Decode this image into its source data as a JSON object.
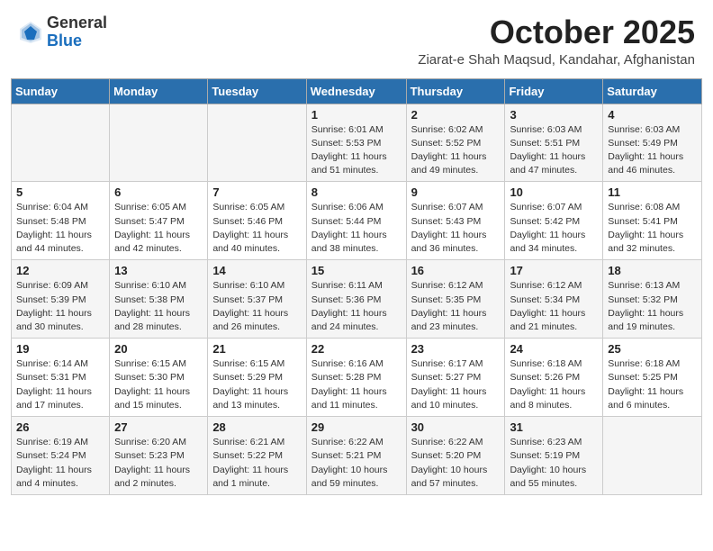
{
  "header": {
    "logo_general": "General",
    "logo_blue": "Blue",
    "month_title": "October 2025",
    "location": "Ziarat-e Shah Maqsud, Kandahar, Afghanistan"
  },
  "days_of_week": [
    "Sunday",
    "Monday",
    "Tuesday",
    "Wednesday",
    "Thursday",
    "Friday",
    "Saturday"
  ],
  "weeks": [
    [
      {
        "num": "",
        "info": ""
      },
      {
        "num": "",
        "info": ""
      },
      {
        "num": "",
        "info": ""
      },
      {
        "num": "1",
        "info": "Sunrise: 6:01 AM\nSunset: 5:53 PM\nDaylight: 11 hours\nand 51 minutes."
      },
      {
        "num": "2",
        "info": "Sunrise: 6:02 AM\nSunset: 5:52 PM\nDaylight: 11 hours\nand 49 minutes."
      },
      {
        "num": "3",
        "info": "Sunrise: 6:03 AM\nSunset: 5:51 PM\nDaylight: 11 hours\nand 47 minutes."
      },
      {
        "num": "4",
        "info": "Sunrise: 6:03 AM\nSunset: 5:49 PM\nDaylight: 11 hours\nand 46 minutes."
      }
    ],
    [
      {
        "num": "5",
        "info": "Sunrise: 6:04 AM\nSunset: 5:48 PM\nDaylight: 11 hours\nand 44 minutes."
      },
      {
        "num": "6",
        "info": "Sunrise: 6:05 AM\nSunset: 5:47 PM\nDaylight: 11 hours\nand 42 minutes."
      },
      {
        "num": "7",
        "info": "Sunrise: 6:05 AM\nSunset: 5:46 PM\nDaylight: 11 hours\nand 40 minutes."
      },
      {
        "num": "8",
        "info": "Sunrise: 6:06 AM\nSunset: 5:44 PM\nDaylight: 11 hours\nand 38 minutes."
      },
      {
        "num": "9",
        "info": "Sunrise: 6:07 AM\nSunset: 5:43 PM\nDaylight: 11 hours\nand 36 minutes."
      },
      {
        "num": "10",
        "info": "Sunrise: 6:07 AM\nSunset: 5:42 PM\nDaylight: 11 hours\nand 34 minutes."
      },
      {
        "num": "11",
        "info": "Sunrise: 6:08 AM\nSunset: 5:41 PM\nDaylight: 11 hours\nand 32 minutes."
      }
    ],
    [
      {
        "num": "12",
        "info": "Sunrise: 6:09 AM\nSunset: 5:39 PM\nDaylight: 11 hours\nand 30 minutes."
      },
      {
        "num": "13",
        "info": "Sunrise: 6:10 AM\nSunset: 5:38 PM\nDaylight: 11 hours\nand 28 minutes."
      },
      {
        "num": "14",
        "info": "Sunrise: 6:10 AM\nSunset: 5:37 PM\nDaylight: 11 hours\nand 26 minutes."
      },
      {
        "num": "15",
        "info": "Sunrise: 6:11 AM\nSunset: 5:36 PM\nDaylight: 11 hours\nand 24 minutes."
      },
      {
        "num": "16",
        "info": "Sunrise: 6:12 AM\nSunset: 5:35 PM\nDaylight: 11 hours\nand 23 minutes."
      },
      {
        "num": "17",
        "info": "Sunrise: 6:12 AM\nSunset: 5:34 PM\nDaylight: 11 hours\nand 21 minutes."
      },
      {
        "num": "18",
        "info": "Sunrise: 6:13 AM\nSunset: 5:32 PM\nDaylight: 11 hours\nand 19 minutes."
      }
    ],
    [
      {
        "num": "19",
        "info": "Sunrise: 6:14 AM\nSunset: 5:31 PM\nDaylight: 11 hours\nand 17 minutes."
      },
      {
        "num": "20",
        "info": "Sunrise: 6:15 AM\nSunset: 5:30 PM\nDaylight: 11 hours\nand 15 minutes."
      },
      {
        "num": "21",
        "info": "Sunrise: 6:15 AM\nSunset: 5:29 PM\nDaylight: 11 hours\nand 13 minutes."
      },
      {
        "num": "22",
        "info": "Sunrise: 6:16 AM\nSunset: 5:28 PM\nDaylight: 11 hours\nand 11 minutes."
      },
      {
        "num": "23",
        "info": "Sunrise: 6:17 AM\nSunset: 5:27 PM\nDaylight: 11 hours\nand 10 minutes."
      },
      {
        "num": "24",
        "info": "Sunrise: 6:18 AM\nSunset: 5:26 PM\nDaylight: 11 hours\nand 8 minutes."
      },
      {
        "num": "25",
        "info": "Sunrise: 6:18 AM\nSunset: 5:25 PM\nDaylight: 11 hours\nand 6 minutes."
      }
    ],
    [
      {
        "num": "26",
        "info": "Sunrise: 6:19 AM\nSunset: 5:24 PM\nDaylight: 11 hours\nand 4 minutes."
      },
      {
        "num": "27",
        "info": "Sunrise: 6:20 AM\nSunset: 5:23 PM\nDaylight: 11 hours\nand 2 minutes."
      },
      {
        "num": "28",
        "info": "Sunrise: 6:21 AM\nSunset: 5:22 PM\nDaylight: 11 hours\nand 1 minute."
      },
      {
        "num": "29",
        "info": "Sunrise: 6:22 AM\nSunset: 5:21 PM\nDaylight: 10 hours\nand 59 minutes."
      },
      {
        "num": "30",
        "info": "Sunrise: 6:22 AM\nSunset: 5:20 PM\nDaylight: 10 hours\nand 57 minutes."
      },
      {
        "num": "31",
        "info": "Sunrise: 6:23 AM\nSunset: 5:19 PM\nDaylight: 10 hours\nand 55 minutes."
      },
      {
        "num": "",
        "info": ""
      }
    ]
  ]
}
